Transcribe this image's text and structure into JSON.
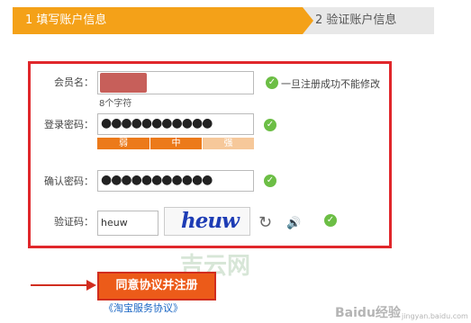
{
  "steps": {
    "step1": "1 填写账户信息",
    "step2": "2 验证账户信息"
  },
  "form": {
    "username_label": "会员名：",
    "username_hint": "8个字符",
    "username_note": "一旦注册成功不能修改",
    "password_label": "登录密码：",
    "password_value": "●●●●●●●●●●●",
    "strength": [
      "弱",
      "中",
      "强"
    ],
    "confirm_label": "确认密码：",
    "confirm_value": "●●●●●●●●●●●",
    "captcha_label": "验证码：",
    "captcha_value": "heuw",
    "captcha_image_text": "heuw"
  },
  "submit_label": "同意协议并注册",
  "agreement_link": "《淘宝服务协议》",
  "watermarks": {
    "site": "吉云网",
    "baidu": "Baidu经验",
    "url": "jingyan.baidu.com"
  },
  "colors": {
    "step_active": "#f4a118",
    "highlight_red": "#e0272b",
    "check_green": "#6cbe45",
    "submit_orange": "#ec5b19"
  },
  "icons": {
    "check": "check-circle-icon",
    "refresh": "refresh-icon",
    "speaker": "speaker-icon"
  }
}
